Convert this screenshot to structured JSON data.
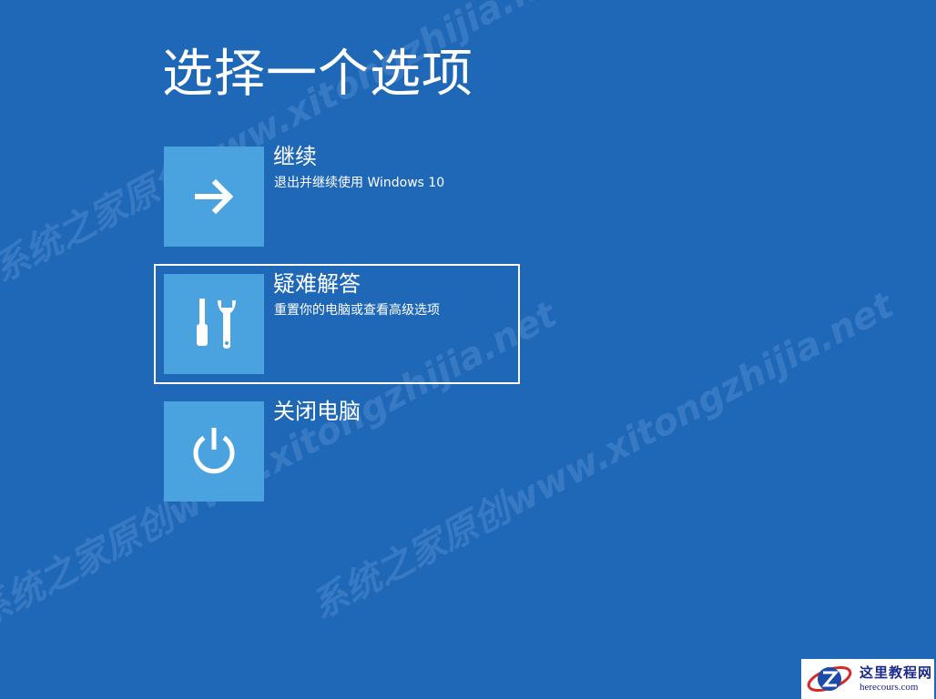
{
  "page": {
    "title": "选择一个选项"
  },
  "options": [
    {
      "label": "继续",
      "description": "退出并继续使用 Windows 10",
      "icon": "arrow-right-icon"
    },
    {
      "label": "疑难解答",
      "description": "重置你的电脑或查看高级选项",
      "icon": "tools-icon"
    },
    {
      "label": "关闭电脑",
      "description": "",
      "icon": "power-icon"
    }
  ],
  "watermark": {
    "text": "系统之家原创www.xitongzhijia.net"
  },
  "logo": {
    "title": "这里教程网",
    "subtitle": "herecours.com"
  },
  "colors": {
    "background": "#1f68b8",
    "tile": "#4aa3df",
    "text": "#ffffff",
    "logo_text": "#1b2a8a"
  }
}
